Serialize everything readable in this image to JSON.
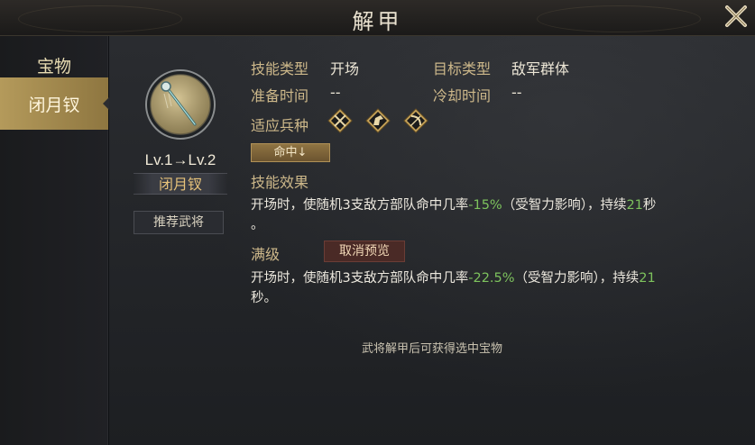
{
  "window": {
    "title": "解甲"
  },
  "sidebar": {
    "items": [
      {
        "label": "宝物"
      },
      {
        "label": "闭月钗"
      }
    ]
  },
  "item": {
    "level": "Lv.1→Lv.2",
    "name": "闭月钗",
    "recommend_label": "推荐武将"
  },
  "skill": {
    "type_label": "技能类型",
    "type_value": "开场",
    "target_label": "目标类型",
    "target_value": "敌军群体",
    "prep_label": "准备时间",
    "prep_value": "--",
    "cooldown_label": "冷却时间",
    "cooldown_value": "--",
    "troops_label": "适应兵种",
    "troop_icons": [
      "spear-cross-icon",
      "horse-icon",
      "bow-icon"
    ],
    "effect_tag": "命中↓",
    "effect_label": "技能效果",
    "effect_desc": {
      "part1": "开场时，使随机3支敌方部队命中几率",
      "value": "-15%",
      "part2": "（受智力影响），持续",
      "duration": "21",
      "part3": "秒",
      "part4": "。"
    },
    "max_label": "满级",
    "cancel_preview_label": "取消预览",
    "max_desc": {
      "part1": "开场时，使随机3支敌方部队命中几率",
      "value": "-22.5%",
      "part2": "（受智力影响），持续",
      "duration": "21",
      "part3": "秒。"
    }
  },
  "footer": {
    "note": "武将解甲后可获得选中宝物"
  },
  "colors": {
    "accent": "#b49a5b",
    "highlight": "#7dc25d",
    "label": "#cdb88a"
  }
}
